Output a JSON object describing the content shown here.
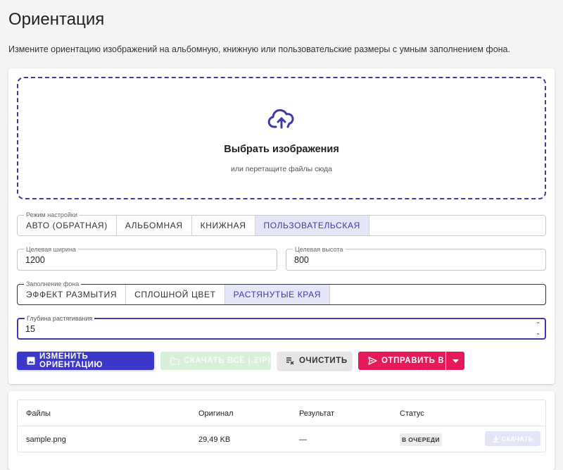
{
  "page": {
    "title": "Ориентация",
    "subtitle": "Измените ориентацию изображений на альбомную, книжную или пользовательские размеры с умным заполнением фона."
  },
  "dropzone": {
    "title": "Выбрать изображения",
    "hint": "или перетащите файлы сюда",
    "icon": "cloud-upload-icon"
  },
  "mode": {
    "legend": "Режим настройки",
    "options": [
      "АВТО (ОБРАТНАЯ)",
      "АЛЬБОМНАЯ",
      "КНИЖНАЯ",
      "ПОЛЬЗОВАТЕЛЬСКАЯ"
    ],
    "selected": "ПОЛЬЗОВАТЕЛЬСКАЯ"
  },
  "width": {
    "label": "Целевая ширина",
    "value": "1200"
  },
  "height": {
    "label": "Целевая высота",
    "value": "800"
  },
  "fill": {
    "legend": "Заполнение фона",
    "options": [
      "ЭФФЕКТ РАЗМЫТИЯ",
      "СПЛОШНОЙ ЦВЕТ",
      "РАСТЯНУТЫЕ КРАЯ"
    ],
    "selected": "РАСТЯНУТЫЕ КРАЯ"
  },
  "depth": {
    "label": "Глубина растягивания",
    "value": "15"
  },
  "actions": {
    "rotate": "ИЗМЕНИТЬ ОРИЕНТАЦИЮ",
    "download_all": "СКАЧАТЬ ВСЁ (.ZIP)",
    "clear": "ОЧИСТИТЬ",
    "send": "ОТПРАВИТЬ В"
  },
  "table": {
    "headers": [
      "Файлы",
      "Оригинал",
      "Результат",
      "Статус"
    ],
    "rows": [
      {
        "file": "sample.png",
        "original": "29,49 KB",
        "result": "—",
        "status": "В ОЧЕРЕДИ",
        "action": "СКАЧАТЬ"
      }
    ]
  },
  "colors": {
    "accent": "#3b37c9",
    "send": "#e6195b",
    "dropzone_border": "#3d3aa8"
  }
}
